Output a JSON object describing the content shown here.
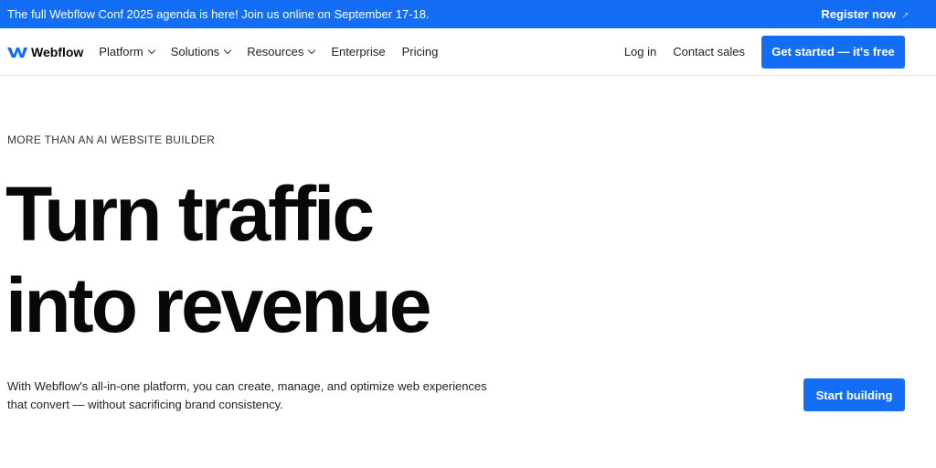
{
  "banner": {
    "text": "The full Webflow Conf 2025 agenda is here! Join us online on September 17-18.",
    "register_label": "Register now",
    "register_icon": "arrow-up-right-icon"
  },
  "nav": {
    "logo_text": "Webflow",
    "items": [
      {
        "label": "Platform",
        "dropdown": true
      },
      {
        "label": "Solutions",
        "dropdown": true
      },
      {
        "label": "Resources",
        "dropdown": true
      },
      {
        "label": "Enterprise",
        "dropdown": false
      },
      {
        "label": "Pricing",
        "dropdown": false
      }
    ],
    "login_label": "Log in",
    "contact_label": "Contact sales",
    "cta_label": "Get started — it's free"
  },
  "hero": {
    "eyebrow": "MORE THAN AN AI WEBSITE BUILDER",
    "headline_line1": "Turn traffic",
    "headline_line2": "into revenue",
    "description": "With Webflow's all-in-one platform, you can create, manage, and optimize web experiences that convert — without sacrificing brand consistency.",
    "cta_label": "Start building"
  },
  "colors": {
    "brand_blue": "#146ef5",
    "text_dark": "#080808"
  }
}
